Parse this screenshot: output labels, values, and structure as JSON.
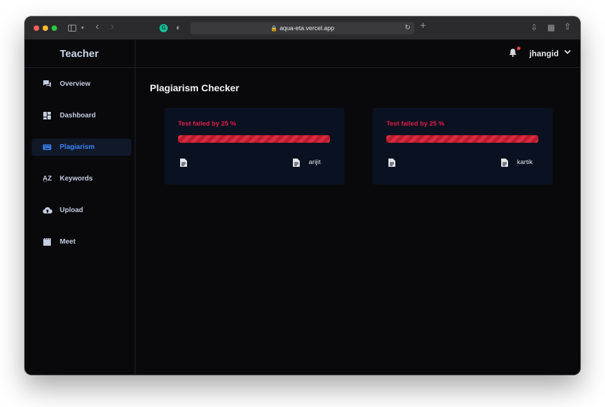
{
  "browser": {
    "url": "aqua-eta.vercel.app"
  },
  "app": {
    "brand": "Teacher",
    "user": "jhangid",
    "notifications_unread": true
  },
  "sidebar": {
    "items": [
      {
        "label": "Overview",
        "icon": "chat-icon",
        "active": false
      },
      {
        "label": "Dashboard",
        "icon": "dashboard-icon",
        "active": false
      },
      {
        "label": "Plagiarism",
        "icon": "keyboard-icon",
        "active": true
      },
      {
        "label": "Keywords",
        "icon": "sort-az-icon",
        "active": false
      },
      {
        "label": "Upload",
        "icon": "cloud-upload-icon",
        "active": false
      },
      {
        "label": "Meet",
        "icon": "clapperboard-icon",
        "active": false
      }
    ]
  },
  "main": {
    "title": "Plagiarism Checker",
    "results": [
      {
        "status": "Test failed by 25 %",
        "progress": 1.0,
        "file_name": "arijit"
      },
      {
        "status": "Test failed by 25 %",
        "progress": 1.0,
        "file_name": "kartik"
      }
    ]
  },
  "colors": {
    "accent": "#3b82f6",
    "danger": "#e11d48",
    "background": "#09090c",
    "card": "#0a1120"
  }
}
